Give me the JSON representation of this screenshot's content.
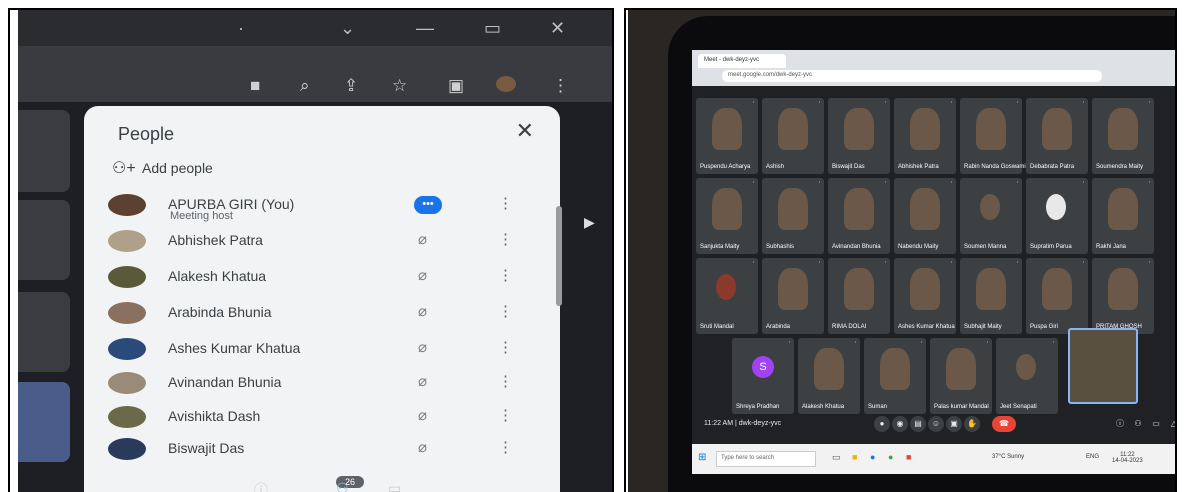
{
  "left": {
    "people_title": "People",
    "add_people": "Add people",
    "badge_count": "26",
    "participants": [
      {
        "name": "APURBA GIRI (You)",
        "sub": "Meeting host"
      },
      {
        "name": "Abhishek Patra"
      },
      {
        "name": "Alakesh Khatua"
      },
      {
        "name": "Arabinda Bhunia"
      },
      {
        "name": "Ashes Kumar Khatua"
      },
      {
        "name": "Avinandan Bhunia"
      },
      {
        "name": "Avishikta Dash"
      },
      {
        "name": "Biswajit Das"
      }
    ]
  },
  "right": {
    "tab_title": "Meet - dwk-deyz-yvc",
    "url": "meet.google.com/dwk-deyz-yvc",
    "meeting_time": "11:22 AM | dwk-deyz-yvc",
    "self_avatar_letter": "S",
    "tiles": [
      "Puspendu Acharya",
      "Ashish",
      "Biswajit Das",
      "Abhishek Patra",
      "Rabin Nanda Goswami",
      "Debabrata Patra",
      "Soumendra Maity",
      "Sanjukta Maity",
      "Subhashis",
      "Avinandan Bhunia",
      "Nabendu Maity",
      "Soumen Manna",
      "Supratim Parua",
      "Rakhi Jana",
      "Sruti Mandal",
      "Arabinda",
      "RIMA DOLAI",
      "Ashes Kumar Khatua",
      "Subhajit Maity",
      "Puspa Giri",
      "PRITAM GHOSH",
      "Shreya Pradhan",
      "Alakesh Khatua",
      "Suman",
      "Palas kumar Mandal",
      "Jeet Senapati"
    ],
    "taskbar": {
      "search_placeholder": "Type here to search",
      "weather": "37°C Sunny",
      "time": "11:22",
      "date": "14-04-2023",
      "lang": "ENG"
    }
  }
}
